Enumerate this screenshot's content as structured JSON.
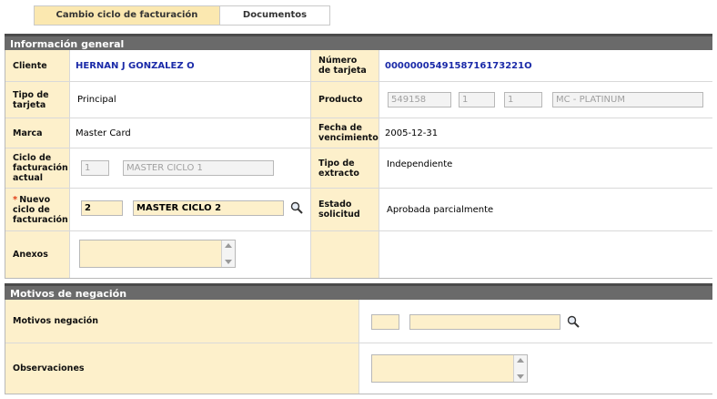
{
  "tabs": [
    {
      "label": "Cambio ciclo de facturación",
      "active": true
    },
    {
      "label": "Documentos",
      "active": false
    }
  ],
  "general": {
    "title": "Información general",
    "cliente_label": "Cliente",
    "cliente_value": "HERNAN J GONZALEZ O",
    "numero_tarjeta_label": "Número de tarjeta",
    "numero_tarjeta_value": "0000000549158716173221O",
    "tipo_tarjeta_label": "Tipo de tarjeta",
    "tipo_tarjeta_value": "Principal",
    "producto_label": "Producto",
    "producto_code": "549158",
    "producto_f1": "1",
    "producto_f2": "1",
    "producto_name": "MC - PLATINUM",
    "marca_label": "Marca",
    "marca_value": "Master Card",
    "fecha_venc_label": "Fecha de vencimiento",
    "fecha_venc_value": "2005-12-31",
    "ciclo_actual_label": "Ciclo de facturación actual",
    "ciclo_actual_code": "1",
    "ciclo_actual_name": "MASTER CICLO 1",
    "tipo_extracto_label": "Tipo de extracto",
    "tipo_extracto_value": "Independiente",
    "nuevo_ciclo_req": "*",
    "nuevo_ciclo_label": "Nuevo ciclo de facturación",
    "nuevo_ciclo_code": "2",
    "nuevo_ciclo_name": "MASTER CICLO 2",
    "estado_label": "Estado solicitud",
    "estado_value": "Aprobada parcialmente",
    "anexos_label": "Anexos"
  },
  "negacion": {
    "title": "Motivos de negación",
    "motivos_label": "Motivos negación",
    "observaciones_label": "Observaciones"
  }
}
